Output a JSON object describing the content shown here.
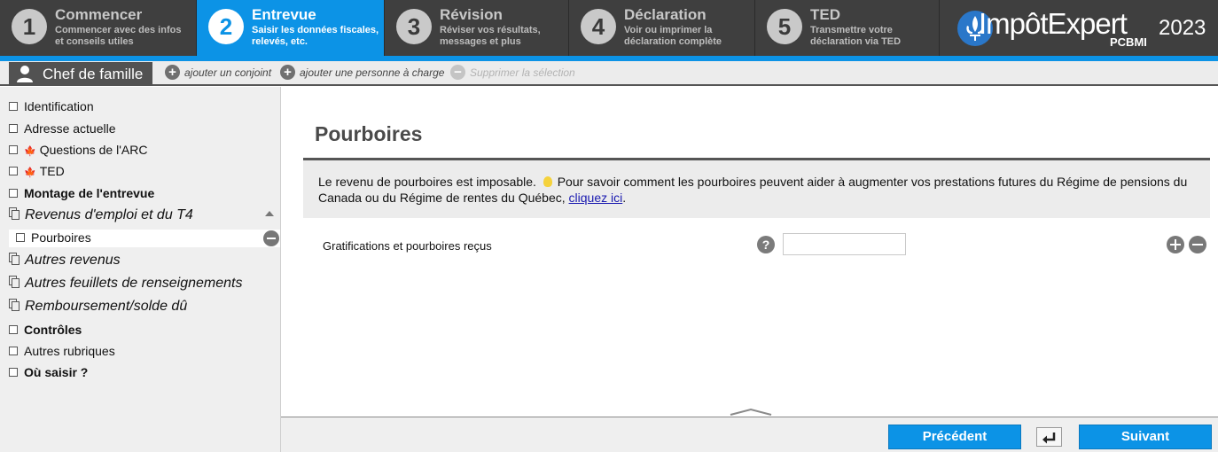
{
  "steps": [
    {
      "number": "1",
      "title": "Commencer",
      "subtitle": "Commencer avec des infos et conseils utiles"
    },
    {
      "number": "2",
      "title": "Entrevue",
      "subtitle": "Saisir les données fiscales, relevés, etc."
    },
    {
      "number": "3",
      "title": "Révision",
      "subtitle": "Réviser vos résultats, messages et plus"
    },
    {
      "number": "4",
      "title": "Déclaration",
      "subtitle": "Voir ou imprimer la déclaration complète"
    },
    {
      "number": "5",
      "title": "TED",
      "subtitle": "Transmettre votre déclaration via TED"
    }
  ],
  "active_step": "2",
  "brand": {
    "name": "ImpôtExpert",
    "sub": "PCBMI",
    "year": "2023"
  },
  "personbar": {
    "person_tab": "Chef de famille",
    "add_spouse": "ajouter un conjoint",
    "add_dependent": "ajouter une personne à charge",
    "delete_selection": "Supprimer la sélection"
  },
  "sidebar": {
    "items": [
      {
        "label": "Identification"
      },
      {
        "label": "Adresse actuelle"
      },
      {
        "label": "Questions de l'ARC"
      },
      {
        "label": "TED"
      },
      {
        "label": "Montage de l'entrevue"
      },
      {
        "label": "Revenus d'emploi et du T4"
      },
      {
        "label": "Pourboires"
      },
      {
        "label": "Autres revenus"
      },
      {
        "label": "Autres feuillets de renseignements"
      },
      {
        "label": "Remboursement/solde dû"
      },
      {
        "label": "Contrôles"
      },
      {
        "label": "Autres rubriques"
      },
      {
        "label": "Où saisir ?"
      }
    ]
  },
  "main": {
    "title": "Pourboires",
    "info_text_1": "Le revenu de pourboires est imposable.",
    "info_text_2": "Pour savoir comment les pourboires peuvent aider à augmenter vos prestations futures du Régime de pensions du Canada ou du Régime de rentes du Québec,",
    "info_link": "cliquez ici",
    "info_end": ".",
    "field_label": "Gratifications et pourboires reçus",
    "field_value": "",
    "help_glyph": "?"
  },
  "footer": {
    "previous": "Précédent",
    "next": "Suivant"
  },
  "colors": {
    "accent": "#0c93e6",
    "topbar": "#3f3f3f",
    "sidebar": "#efefef",
    "canada_leaf": "#d42020"
  },
  "icons": {
    "help": "question-circle-icon",
    "add": "plus-circle-icon",
    "remove": "minus-circle-icon",
    "back": "return-arrow-icon",
    "leaf": "maple-leaf-icon",
    "bulb": "lightbulb-icon",
    "user": "user-icon",
    "pages": "pages-icon",
    "checkbox": "checkbox-icon"
  }
}
